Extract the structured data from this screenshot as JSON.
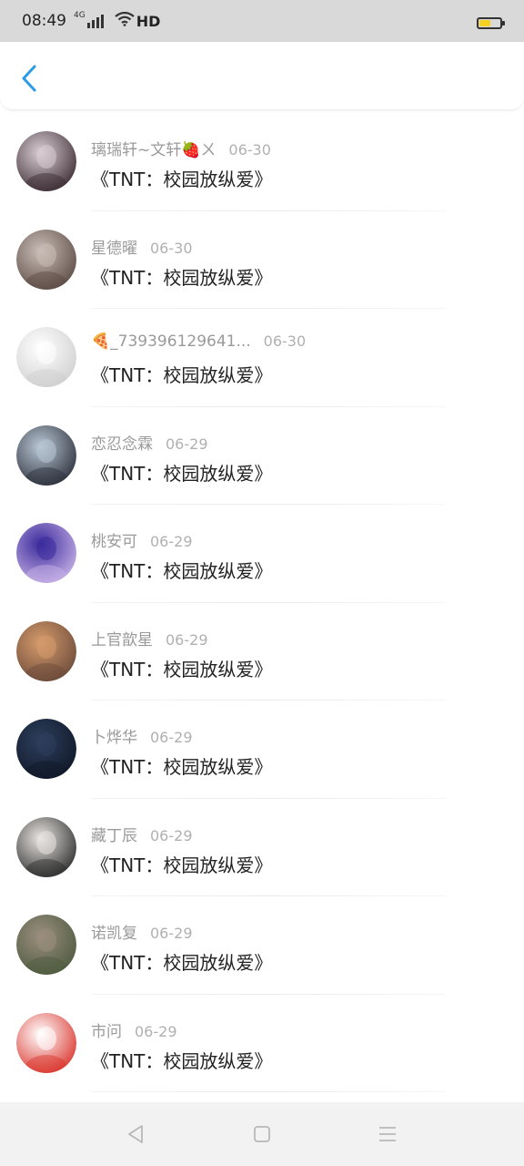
{
  "status_bar": {
    "time": "08:49",
    "network": "4G",
    "hd": "HD",
    "battery_level": 0.55,
    "icons": [
      "signal-icon",
      "wifi-icon",
      "battery-icon"
    ]
  },
  "app_bar": {
    "back_icon": "chevron-left-icon",
    "accent_color": "#2a9be8"
  },
  "list": {
    "items": [
      {
        "name": "璃瑞轩~文轩🍓ㄨ",
        "date": "06-30",
        "title": "《TNT：校园放纵爱》",
        "avatar_colors": [
          "#d9cdd3",
          "#3a2b31"
        ]
      },
      {
        "name": "星德曜",
        "date": "06-30",
        "title": "《TNT：校园放纵爱》",
        "avatar_colors": [
          "#c9bdb7",
          "#5b4a43"
        ]
      },
      {
        "name": "🍕_739396129641...",
        "date": "06-30",
        "title": "《TNT：校园放纵爱》",
        "avatar_colors": [
          "#ffffff",
          "#cfcfcf"
        ]
      },
      {
        "name": "恋忍念霖",
        "date": "06-29",
        "title": "《TNT：校园放纵爱》",
        "avatar_colors": [
          "#b8c6d4",
          "#2b2f3a"
        ]
      },
      {
        "name": "桃安可",
        "date": "06-29",
        "title": "《TNT：校园放纵爱》",
        "avatar_colors": [
          "#3c2c9c",
          "#c9b3e8"
        ]
      },
      {
        "name": "上官歆星",
        "date": "06-29",
        "title": "《TNT：校园放纵爱》",
        "avatar_colors": [
          "#d59a6b",
          "#6a4a3a"
        ]
      },
      {
        "name": "卜烨华",
        "date": "06-29",
        "title": "《TNT：校园放纵爱》",
        "avatar_colors": [
          "#2d3e5c",
          "#101828"
        ]
      },
      {
        "name": "藏丁辰",
        "date": "06-29",
        "title": "《TNT：校园放纵爱》",
        "avatar_colors": [
          "#e8e4e0",
          "#2a2a2a"
        ]
      },
      {
        "name": "诺凯复",
        "date": "06-29",
        "title": "《TNT：校园放纵爱》",
        "avatar_colors": [
          "#9a8e7e",
          "#4d5a3e"
        ]
      },
      {
        "name": "市问",
        "date": "06-29",
        "title": "《TNT：校园放纵爱》",
        "avatar_colors": [
          "#ffffff",
          "#d9332a"
        ]
      }
    ]
  },
  "nav_bar": {
    "icons": [
      "back-triangle-icon",
      "home-square-icon",
      "menu-lines-icon"
    ]
  }
}
